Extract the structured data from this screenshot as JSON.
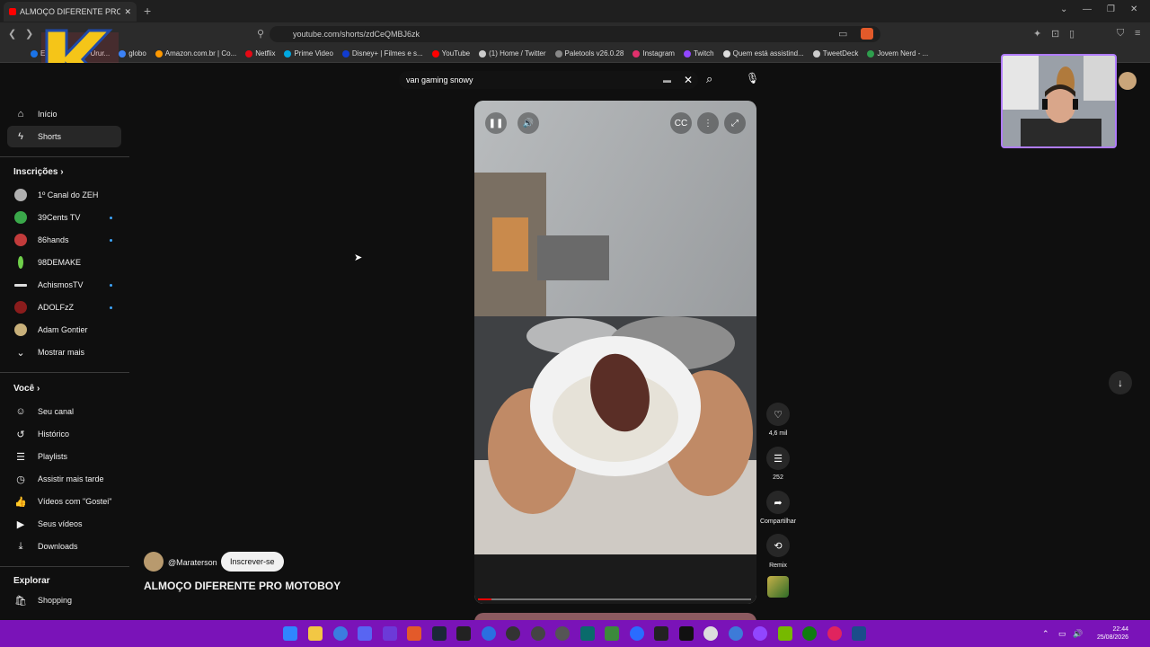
{
  "browser": {
    "tab_title": "ALMOÇO DIFERENTE PRO M",
    "url": "youtube.com/shorts/zdCeQMBJ6zk",
    "bookmarks": [
      {
        "label": "Email – Thiago Urur...",
        "color": "#1a73e8"
      },
      {
        "label": "globo",
        "color": "#3b82f6"
      },
      {
        "label": "Amazon.com.br | Co...",
        "color": "#ff9900"
      },
      {
        "label": "Netflix",
        "color": "#e50914"
      },
      {
        "label": "Prime Video",
        "color": "#00a8e1"
      },
      {
        "label": "Disney+ | Filmes e s...",
        "color": "#113ccf"
      },
      {
        "label": "YouTube",
        "color": "#ff0000"
      },
      {
        "label": "(1) Home / Twitter",
        "color": "#cccccc"
      },
      {
        "label": "Paletools v26.0.28",
        "color": "#888888"
      },
      {
        "label": "Instagram",
        "color": "#e1306c"
      },
      {
        "label": "Twitch",
        "color": "#9146ff"
      },
      {
        "label": "Quem está assistind...",
        "color": "#dddddd"
      },
      {
        "label": "TweetDeck",
        "color": "#cccccc"
      },
      {
        "label": "Jovem Nerd - ...",
        "color": "#2e9e4d"
      }
    ]
  },
  "overlay": {
    "logo_text": "KTV"
  },
  "search": {
    "query": "van gaming snowy"
  },
  "sidebar": {
    "main": [
      {
        "label": "Início",
        "icon": "home-icon"
      },
      {
        "label": "Shorts",
        "icon": "shorts-icon"
      }
    ],
    "subscriptions_heading": "Inscrições",
    "subscriptions": [
      {
        "label": "1º Canal do ZEH",
        "color": "#b0b0b0",
        "new": false
      },
      {
        "label": "39Cents TV",
        "color": "#3aa84a",
        "new": true
      },
      {
        "label": "86hands",
        "color": "#c23b3b",
        "new": true
      },
      {
        "label": "98DEMAKE",
        "color": "#6fcf4a",
        "new": false
      },
      {
        "label": "AchismosTV",
        "color": "#dddddd",
        "new": true
      },
      {
        "label": "ADOLFzZ",
        "color": "#8a1c1c",
        "new": true
      },
      {
        "label": "Adam Gontier",
        "color": "#c8b07a",
        "new": false
      }
    ],
    "show_more": "Mostrar mais",
    "you_heading": "Você",
    "you": [
      {
        "label": "Seu canal",
        "icon": "channel-icon"
      },
      {
        "label": "Histórico",
        "icon": "history-icon"
      },
      {
        "label": "Playlists",
        "icon": "playlist-icon"
      },
      {
        "label": "Assistir mais tarde",
        "icon": "clock-icon"
      },
      {
        "label": "Vídeos com \"Gostei\"",
        "icon": "thumbs-up-icon"
      },
      {
        "label": "Seus vídeos",
        "icon": "video-icon"
      },
      {
        "label": "Downloads",
        "icon": "download-icon"
      }
    ],
    "explore_heading": "Explorar",
    "explore": [
      {
        "label": "Shopping",
        "icon": "shopping-icon"
      }
    ]
  },
  "short": {
    "channel": "@Maraterson",
    "subscribe": "Inscrever-se",
    "title": "ALMOÇO DIFERENTE PRO MOTOBOY",
    "likes": "4,6 mil",
    "comments": "252",
    "share": "Compartilhar",
    "remix": "Remix",
    "progress": 0.05
  },
  "taskbar": {
    "time": "22:44",
    "date": "25/08/2026",
    "color": "#7a13b8"
  }
}
